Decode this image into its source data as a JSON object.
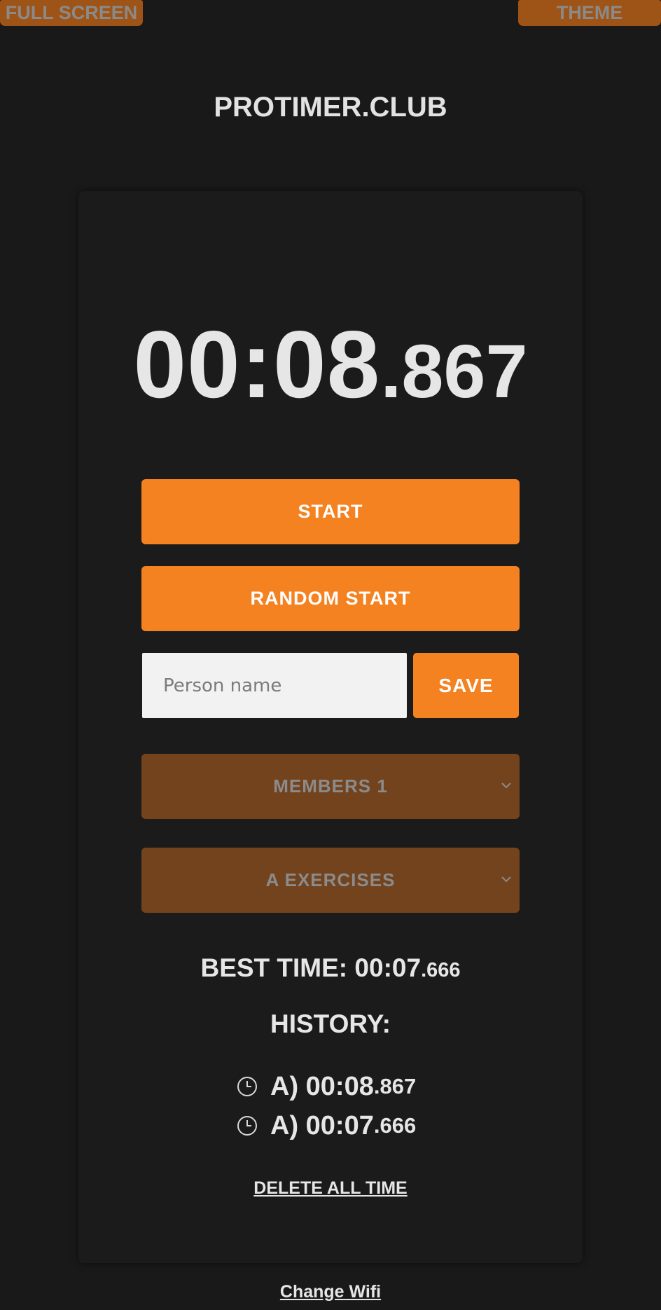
{
  "header": {
    "fullscreen_label": "FULL SCREEN",
    "theme_label": "THEME",
    "site_title": "PROTIMER.CLUB"
  },
  "timer": {
    "main": "00:08",
    "ms": ".867"
  },
  "controls": {
    "start_label": "START",
    "random_start_label": "RANDOM START",
    "name_placeholder": "Person name",
    "name_value": "",
    "save_label": "SAVE"
  },
  "selects": {
    "members": "MEMBERS 1",
    "exercises": "A EXERCISES"
  },
  "best_time": {
    "label": "BEST TIME: ",
    "main": "00:07",
    "ms": ".666"
  },
  "history": {
    "title": "HISTORY:",
    "items": [
      {
        "main": "A) 00:08",
        "ms": ".867"
      },
      {
        "main": "A) 00:07",
        "ms": ".666"
      }
    ]
  },
  "links": {
    "delete_all": "DELETE ALL TIME",
    "change_wifi": "Change Wifi"
  },
  "colors": {
    "accent": "#f48221",
    "select_bg": "#73431d",
    "page_bg": "#191919"
  }
}
